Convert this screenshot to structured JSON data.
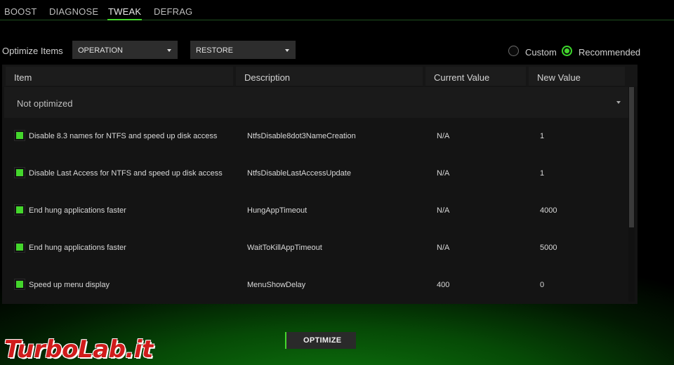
{
  "tabs": [
    {
      "label": "BOOST"
    },
    {
      "label": "DIAGNOSE"
    },
    {
      "label": "TWEAK"
    },
    {
      "label": "DEFRAG"
    }
  ],
  "active_tab": "TWEAK",
  "optimize_items_label": "Optimize Items",
  "dropdowns": {
    "operation": "OPERATION",
    "restore": "RESTORE"
  },
  "mode": {
    "custom": "Custom",
    "recommended": "Recommended",
    "selected": "Recommended"
  },
  "table": {
    "columns": [
      "Item",
      "Description",
      "Current Value",
      "New Value"
    ],
    "group_label": "Not optimized",
    "rows": [
      {
        "item": "Disable 8.3 names for NTFS and speed up disk access",
        "description": "NtfsDisable8dot3NameCreation",
        "current": "N/A",
        "new": "1",
        "checked": true
      },
      {
        "item": "Disable Last Access for NTFS and speed up disk access",
        "description": "NtfsDisableLastAccessUpdate",
        "current": "N/A",
        "new": "1",
        "checked": true
      },
      {
        "item": "End hung applications faster",
        "description": "HungAppTimeout",
        "current": "N/A",
        "new": "4000",
        "checked": true
      },
      {
        "item": "End hung applications faster",
        "description": "WaitToKillAppTimeout",
        "current": "N/A",
        "new": "5000",
        "checked": true
      },
      {
        "item": "Speed up menu display",
        "description": "MenuShowDelay",
        "current": "400",
        "new": "0",
        "checked": true
      }
    ]
  },
  "optimize_button": "OPTIMIZE",
  "watermark": "TurboLab.it",
  "colors": {
    "accent": "#44d62c",
    "background": "#000000",
    "panel": "#141414",
    "watermark": "#d01b1b"
  },
  "icons": {
    "dropdown": "chevron-down-icon",
    "checkbox": "checkbox-checked-icon"
  }
}
